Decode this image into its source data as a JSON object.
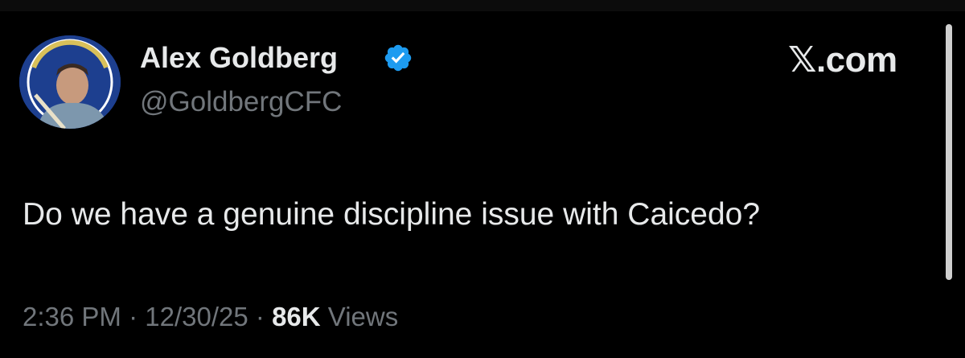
{
  "author": {
    "display_name": "Alex Goldberg",
    "handle": "@GoldbergCFC",
    "verified_icon": "verified-badge-icon",
    "avatar_icon": "profile-avatar"
  },
  "brand": {
    "label": "𝕏.com"
  },
  "tweet": {
    "text": "Do we have a genuine discipline issue with Caicedo?"
  },
  "meta": {
    "time": "2:36 PM",
    "sep1": "·",
    "date": "12/30/25",
    "sep2": "·",
    "views_count": "86K",
    "views_label": "Views"
  },
  "colors": {
    "background": "#000000",
    "primary_text": "#e7e9ea",
    "secondary_text": "#71767b",
    "verified_blue": "#1d9bf0"
  }
}
